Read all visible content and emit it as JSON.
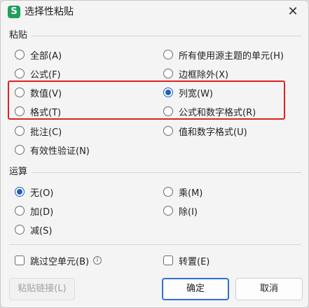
{
  "window": {
    "title": "选择性粘贴",
    "app_icon_letter": "S"
  },
  "paste": {
    "label": "粘贴",
    "left": [
      "全部(A)",
      "公式(F)",
      "数值(V)",
      "格式(T)",
      "批注(C)",
      "有效性验证(N)"
    ],
    "right": [
      "所有使用源主题的单元(H)",
      "边框除外(X)",
      "列宽(W)",
      "公式和数字格式(R)",
      "值和数字格式(U)"
    ],
    "selected": "列宽(W)"
  },
  "operation": {
    "label": "运算",
    "left": [
      "无(O)",
      "加(D)",
      "减(S)"
    ],
    "right": [
      "乘(M)",
      "除(I)"
    ],
    "selected": "无(O)"
  },
  "options": {
    "skip_blanks": "跳过空单元(B)",
    "transpose": "转置(E)",
    "info_glyph": "i"
  },
  "buttons": {
    "paste_link": "粘贴链接(L)",
    "ok": "确定",
    "cancel": "取消"
  },
  "colors": {
    "accent": "#1f5fbf",
    "highlight": "#e02020",
    "app_icon": "#1fa05a"
  }
}
